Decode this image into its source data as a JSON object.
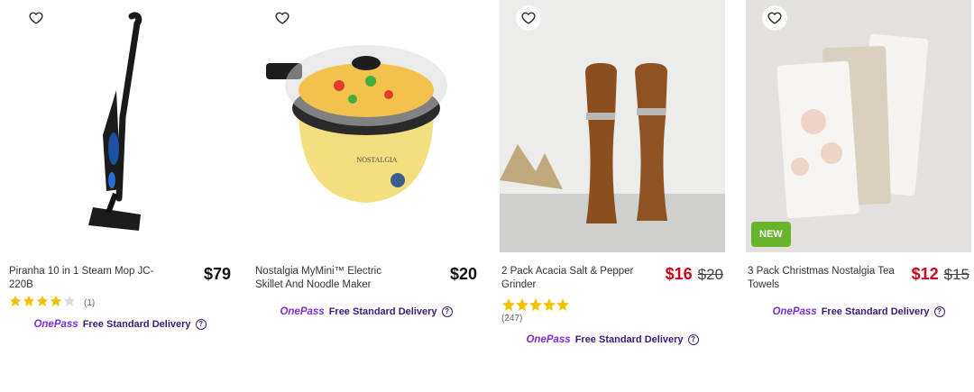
{
  "products": [
    {
      "title": "Piranha 10 in 1 Steam Mop JC-220B",
      "price": "$79",
      "rating_count": "(1)",
      "stars": 4,
      "delivery": "Free Standard Delivery",
      "onepass": "OnePass"
    },
    {
      "title": "Nostalgia MyMini™ Electric Skillet And Noodle Maker",
      "price": "$20",
      "delivery": "Free Standard Delivery",
      "onepass": "OnePass",
      "brand_text": "NOSTALGIA"
    },
    {
      "title": "2 Pack Acacia Salt & Pepper Grinder",
      "price": "$16",
      "was_price": "$20",
      "rating_count": "(247)",
      "stars": 4.5,
      "delivery": "Free Standard Delivery",
      "onepass": "OnePass"
    },
    {
      "title": "3 Pack Christmas Nostalgia Tea Towels",
      "price": "$12",
      "was_price": "$15",
      "badge": "NEW",
      "delivery": "Free Standard Delivery",
      "onepass": "OnePass"
    }
  ],
  "colors": {
    "sale": "#d0021b",
    "onepass": "#7a2fd6",
    "new_badge": "#67b52b",
    "star": "#f2c200"
  },
  "icons": {
    "favourite": "heart-outline-icon",
    "info": "info-icon",
    "star": "star-icon"
  }
}
